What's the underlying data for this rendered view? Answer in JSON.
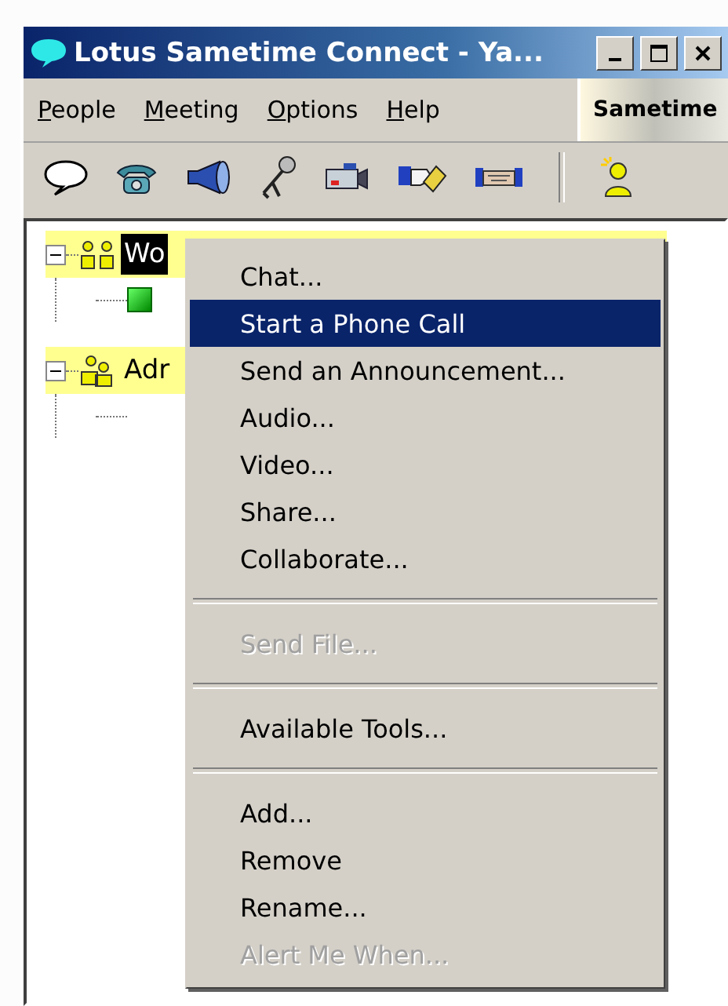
{
  "window": {
    "title": "Lotus Sametime Connect - Ya..."
  },
  "menu_bar": [
    {
      "label": "People"
    },
    {
      "label": "Meeting"
    },
    {
      "label": "Options"
    },
    {
      "label": "Help"
    }
  ],
  "brand": {
    "label": "Sametime"
  },
  "toolbar": [
    {
      "kind": "chat"
    },
    {
      "kind": "phone"
    },
    {
      "kind": "announce"
    },
    {
      "kind": "microphone"
    },
    {
      "kind": "camera"
    },
    {
      "kind": "share"
    },
    {
      "kind": "collaborate"
    },
    {
      "kind": "separator"
    },
    {
      "kind": "person"
    }
  ],
  "tree": [
    {
      "label": "Wo",
      "selected": true,
      "expanded": true,
      "children": [
        {
          "online": true
        }
      ]
    },
    {
      "label": "Adr",
      "selected": false,
      "expanded": true,
      "children": [
        {
          "online": false
        }
      ]
    }
  ],
  "context_menu": [
    {
      "kind": "item",
      "label": "Chat...",
      "selected": false,
      "disabled": false
    },
    {
      "kind": "item",
      "label": "Start a Phone Call",
      "selected": true,
      "disabled": false
    },
    {
      "kind": "item",
      "label": "Send an Announcement...",
      "selected": false,
      "disabled": false
    },
    {
      "kind": "item",
      "label": "Audio...",
      "selected": false,
      "disabled": false
    },
    {
      "kind": "item",
      "label": "Video...",
      "selected": false,
      "disabled": false
    },
    {
      "kind": "item",
      "label": "Share...",
      "selected": false,
      "disabled": false
    },
    {
      "kind": "item",
      "label": "Collaborate...",
      "selected": false,
      "disabled": false
    },
    {
      "kind": "separator"
    },
    {
      "kind": "item",
      "label": "Send File...",
      "selected": false,
      "disabled": true
    },
    {
      "kind": "separator"
    },
    {
      "kind": "item",
      "label": "Available Tools...",
      "selected": false,
      "disabled": false
    },
    {
      "kind": "separator"
    },
    {
      "kind": "item",
      "label": "Add...",
      "selected": false,
      "disabled": false
    },
    {
      "kind": "item",
      "label": "Remove",
      "selected": false,
      "disabled": false
    },
    {
      "kind": "item",
      "label": "Rename...",
      "selected": false,
      "disabled": false
    },
    {
      "kind": "item",
      "label": "Alert Me When...",
      "selected": false,
      "disabled": true
    }
  ]
}
